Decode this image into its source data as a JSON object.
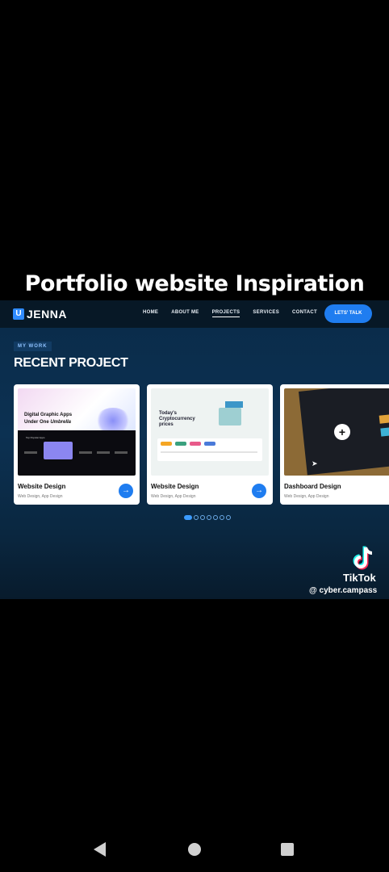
{
  "caption": "Portfolio website Inspiration",
  "site": {
    "logo_mark": "U",
    "logo_text": "JENNA",
    "nav": [
      "HOME",
      "ABOUT ME",
      "PROJECTS",
      "SERVICES",
      "CONTACT"
    ],
    "active_nav": "PROJECTS",
    "cta_label": "LETS' TALK",
    "eyebrow": "MY WORK",
    "section_title": "RECENT PROJECT",
    "cards": [
      {
        "title": "Website Design",
        "subtitle": "Web Design, App Design",
        "thumb": {
          "headline_1": "Digital Graphic Apps",
          "headline_2": "Under One ",
          "headline_italic": "Umbrella",
          "panel_label": "Top Popular Apps"
        }
      },
      {
        "title": "Website Design",
        "subtitle": "Web Design, App Design",
        "thumb": {
          "headline": "Today's Cryptocurrency prices"
        }
      },
      {
        "title": "Dashboard Design",
        "subtitle": "Web Design, App Design",
        "thumb": {}
      }
    ],
    "carousel": {
      "count": 7,
      "active_index": 0
    }
  },
  "overlay": {
    "brand": "TikTok",
    "handle": "@ cyber.campass"
  },
  "colors": {
    "accent": "#1f7df0",
    "page_bg": "#000000",
    "site_bg": "#0c3152"
  }
}
